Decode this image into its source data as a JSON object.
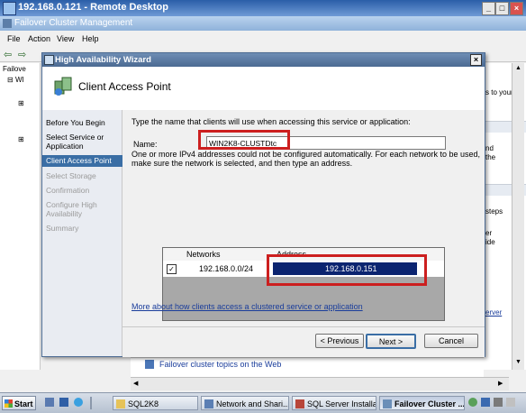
{
  "remote_desktop": {
    "title": "192.168.0.121 - Remote Desktop"
  },
  "window": {
    "title": "Failover Cluster Management"
  },
  "menu": [
    "File",
    "Action",
    "View",
    "Help"
  ],
  "tree": {
    "root_label": "Failove",
    "child_label": "WI"
  },
  "wizard": {
    "title": "High Availability Wizard",
    "header_title": "Client Access Point",
    "nav": [
      {
        "label": "Before You Begin",
        "state": "normal"
      },
      {
        "label": "Select Service or Application",
        "state": "normal"
      },
      {
        "label": "Client Access Point",
        "state": "active"
      },
      {
        "label": "Select Storage",
        "state": "disabled"
      },
      {
        "label": "Confirmation",
        "state": "disabled"
      },
      {
        "label": "Configure High Availability",
        "state": "disabled"
      },
      {
        "label": "Summary",
        "state": "disabled"
      }
    ],
    "instruction": "Type the name that clients will use when accessing this service or application:",
    "name_label": "Name:",
    "name_value": "WIN2K8-CLUSTDtc",
    "ipv4_note": "One or more IPv4 addresses could not be configured automatically.  For each network to be used, make sure the network is selected, and then type an address.",
    "grid": {
      "headers": {
        "networks": "Networks",
        "address": "Address"
      },
      "rows": [
        {
          "checked": true,
          "network": "192.168.0.0/24",
          "address": "192.168.0.151"
        }
      ]
    },
    "more_link": "More about how clients access a clustered service or application",
    "buttons": {
      "previous": "< Previous",
      "next": "Next >",
      "cancel": "Cancel"
    }
  },
  "behind_right": {
    "line1": "s to your",
    "line2": "nd",
    "line3": "the",
    "line4": "steps",
    "line5": "er",
    "line6": "ide",
    "line7": "erver"
  },
  "behind_bottom": {
    "link": "Failover cluster topics on the Web"
  },
  "taskbar": {
    "start": "Start",
    "tasks": [
      {
        "label": "SQL2K8"
      },
      {
        "label": "Network and Shari..."
      },
      {
        "label": "SQL Server Installa..."
      },
      {
        "label": "Failover Cluster ..."
      }
    ],
    "clock": "5:19 PM"
  },
  "colors": {
    "accent": "#3a6ea5",
    "highlight_box": "#cc1f1f",
    "address_cell": "#0b2470"
  }
}
